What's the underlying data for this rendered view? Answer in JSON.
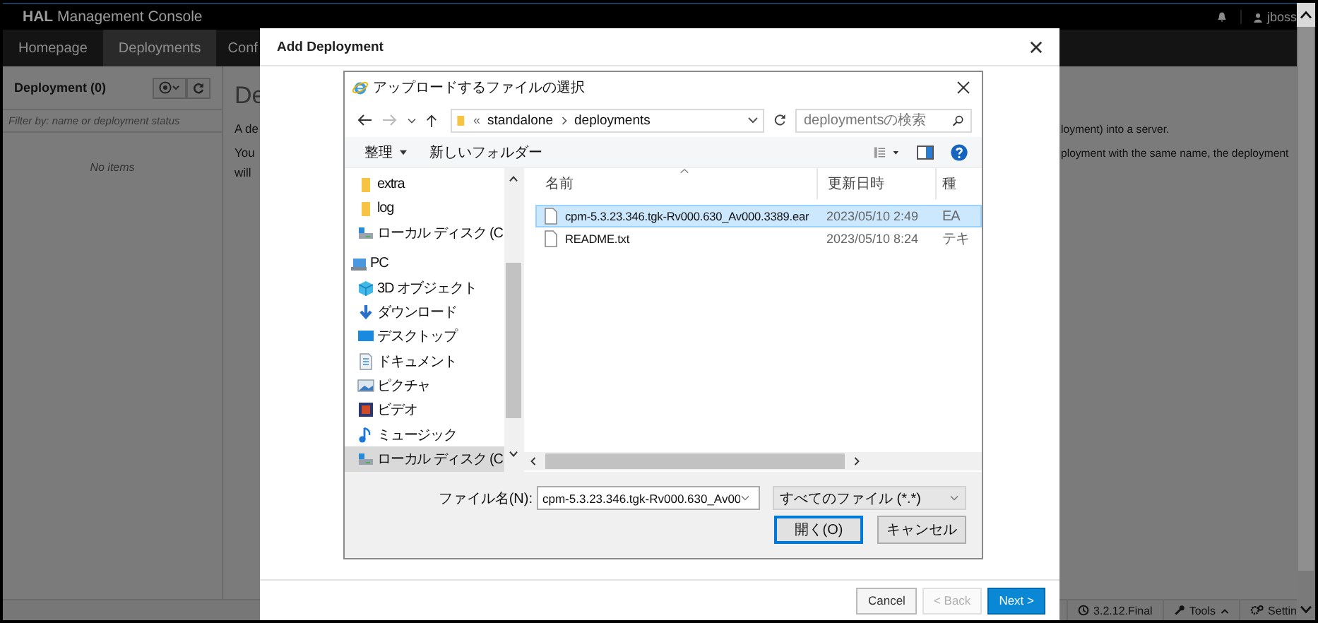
{
  "app": {
    "brand": "**HAL** Management Console",
    "user": "jboss",
    "nav_tabs": [
      {
        "label": "Homepage",
        "selected": false
      },
      {
        "label": "Deployments",
        "selected": true
      },
      {
        "label": "Conf",
        "selected": false
      }
    ],
    "deployment_panel": {
      "title": "Deployment (0)",
      "filter_placeholder": "Filter by: name or deployment status",
      "empty_text": "No items"
    },
    "content": {
      "heading": "De",
      "left_fragments": [
        "A de",
        "You",
        "will"
      ],
      "right_fragments": [
        "loyment) into a server.",
        "ployment with the same name, the deployment"
      ]
    },
    "footer": [
      {
        "label": "3.2.12.Final",
        "kind": "info"
      },
      {
        "label": "Tools",
        "kind": "tools"
      },
      {
        "label": "Settin",
        "kind": "settings"
      }
    ]
  },
  "modal": {
    "title": "Add Deployment",
    "buttons": [
      {
        "label": "Cancel",
        "kind": "default",
        "disabled": false
      },
      {
        "label": "< Back",
        "kind": "default",
        "disabled": true
      },
      {
        "label": "Next >",
        "kind": "primary",
        "disabled": false
      }
    ]
  },
  "file_dialog": {
    "title": "アップロードするファイルの選択",
    "path_prefix": "«",
    "path": [
      "standalone",
      "deployments"
    ],
    "search_placeholder": "deploymentsの検索",
    "toolbar": [
      {
        "label": "整理",
        "kind": "menu"
      },
      {
        "label": "新しいフォルダー",
        "kind": "plain"
      }
    ],
    "nav_items": [
      {
        "label": "extra",
        "kind": "folder",
        "selected": false
      },
      {
        "label": "log",
        "kind": "folder",
        "selected": false
      },
      {
        "label": "ローカル ディスク (C",
        "kind": "drive",
        "selected": false
      },
      {
        "label": "PC",
        "kind": "pc",
        "selected": false,
        "children": [
          {
            "label": "3D オブジェクト",
            "kind": "objects3d",
            "selected": false
          },
          {
            "label": "ダウンロード",
            "kind": "download",
            "selected": false
          },
          {
            "label": "デスクトップ",
            "kind": "desktop",
            "selected": false
          },
          {
            "label": "ドキュメント",
            "kind": "documents",
            "selected": false
          },
          {
            "label": "ピクチャ",
            "kind": "pictures",
            "selected": false
          },
          {
            "label": "ビデオ",
            "kind": "videos",
            "selected": false
          },
          {
            "label": "ミュージック",
            "kind": "music",
            "selected": false
          },
          {
            "label": "ローカル ディスク (C",
            "kind": "drive",
            "selected": true
          }
        ]
      }
    ],
    "columns": [
      "名前",
      "更新日時",
      "種"
    ],
    "files": [
      {
        "name": "cpm-5.3.23.346.tgk-Rv000.630_Av000.3389.ear",
        "modified": "2023/05/10 2:49",
        "type": "EA",
        "selected": true
      },
      {
        "name": "README.txt",
        "modified": "2023/05/10 8:24",
        "type": "テキ",
        "selected": false
      }
    ],
    "file_name_label": "ファイル名(N):",
    "file_name": "cpm-5.3.23.346.tgk-Rv000.630_Av00",
    "file_type": "すべてのファイル (*.*)",
    "buttons": [
      {
        "label": "開く(O)",
        "default": true
      },
      {
        "label": "キャンセル",
        "default": false
      }
    ]
  }
}
